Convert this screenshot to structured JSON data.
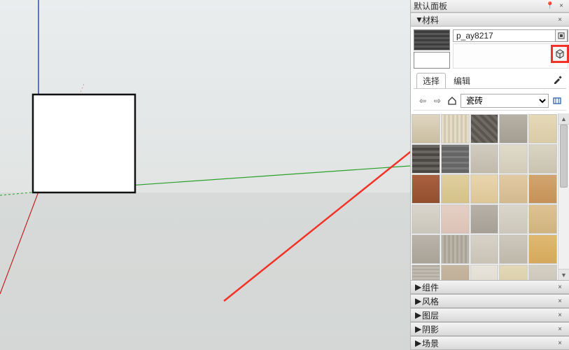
{
  "panel": {
    "title": "默认面板",
    "pin_icon": "pin-icon",
    "close_icon": "close-icon"
  },
  "materials": {
    "header": "材料",
    "name_value": "p_ay8217",
    "create_icon": "new-material-icon",
    "tabs": {
      "select": "选择",
      "edit": "编辑"
    },
    "eyedropper_icon": "eyedropper-icon",
    "nav": {
      "back_icon": "back-icon",
      "fwd_icon": "forward-icon",
      "home_icon": "home-icon",
      "lib_icon": "library-icon"
    },
    "category": "瓷砖",
    "tiles": [
      "linear-gradient(#e0d6c0,#c9bda1)",
      "repeating-linear-gradient(90deg,#e5ddca 0 3px,#d4cab0 3px 6px)",
      "repeating-linear-gradient(45deg,#6f6a63 0 4px,#5a564f 4px 8px)",
      "linear-gradient(#b7b1a6,#a39d92)",
      "linear-gradient(#e6d9b8,#d9cba6)",
      "repeating-linear-gradient(0deg,#4b4844 0 4px,#696560 4px 8px)",
      "repeating-linear-gradient(0deg,#666 0 5px,#7a7a7a 5px 8px)",
      "linear-gradient(#d2ccc0,#c1baab)",
      "linear-gradient(#e0daca,#d2cbb8)",
      "linear-gradient(#d9d3c3,#cac3b0)",
      "linear-gradient(#a9603f,#92502f)",
      "linear-gradient(#e0cf9e,#d4c18a)",
      "linear-gradient(#e9d5ad,#dcc696)",
      "linear-gradient(#e1c9a3,#d3b98e)",
      "linear-gradient(#d2a46e,#c49258)",
      "linear-gradient(#d9d5cc,#cac5ba)",
      "linear-gradient(#e5cfc5,#dcc2b6)",
      "linear-gradient(#b7b1a8,#a59f95)",
      "linear-gradient(#dad6cb,#ccc7ba)",
      "linear-gradient(#ddc293,#d0b37e)",
      "linear-gradient(#b9b4aa,#a8a397)",
      "repeating-linear-gradient(90deg,#bbb5a9 0 3px,#aaa497 3px 6px)",
      "linear-gradient(#d7d2c7,#c9c3b6)",
      "linear-gradient(#cdc8bc,#bdb8aa)",
      "linear-gradient(#e0b871,#d4a95c)",
      "repeating-linear-gradient(0deg,#c0bab0 0 3px,#b0aa9f 3px 5px)",
      "linear-gradient(#c7b7a1,#b8a88f)",
      "linear-gradient(#e8e4db,#dcd7cc)",
      "linear-gradient(#e3d8b7,#d7cba3)",
      "linear-gradient(#d5d0c5,#c6c0b3)"
    ]
  },
  "collapsed": {
    "components": "组件",
    "styles": "风格",
    "layers": "图层",
    "shadows": "阴影",
    "scenes": "场景"
  }
}
